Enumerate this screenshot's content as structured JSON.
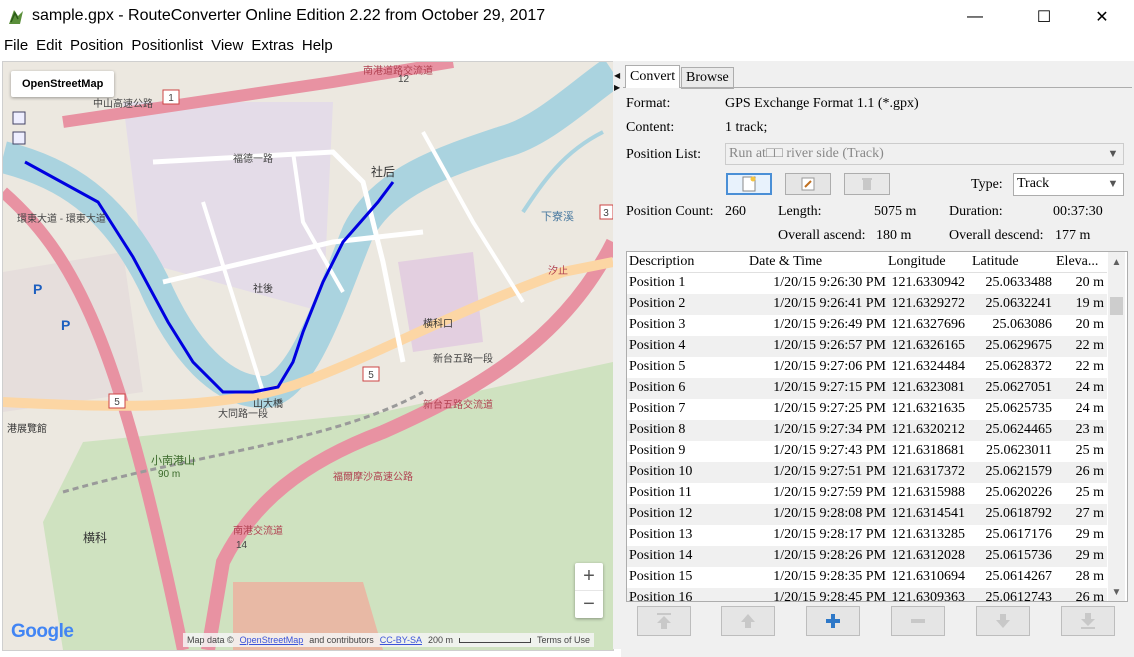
{
  "window": {
    "title": "sample.gpx - RouteConverter Online Edition 2.22 from October 29, 2017",
    "minimize_glyph": "—",
    "maximize_glyph": "☐",
    "close_glyph": "✕"
  },
  "menu": [
    "File",
    "Edit",
    "Position",
    "Positionlist",
    "View",
    "Extras",
    "Help"
  ],
  "map": {
    "type_button": "OpenStreetMap",
    "zoom_in": "+",
    "zoom_out": "−",
    "google_logo": "Google",
    "attribution_prefix": "Map data ©",
    "attribution_osm": "OpenStreetMap",
    "attribution_mid": "and contributors",
    "attribution_license": "CC-BY-SA",
    "scale": "200 m",
    "terms": "Terms of Use",
    "labels": {
      "top_road": "南港道路交流道",
      "left_road": "環東大道 - 環東大道",
      "highway_1": "中山高速公路",
      "place_1": "福德一路",
      "place_2": "社后",
      "place_3": "社後",
      "place_4": "大同路一段",
      "place_5": "福爾摩沙高速公路",
      "place_6": "新台五路交流道",
      "place_7": "小南港山",
      "place_8": "90 m",
      "place_9": "南港交流道",
      "place_10": "新台五路一段",
      "place_11": "横科口",
      "place_12": "港展覽館",
      "place_13": "横科",
      "place_14": "汐止",
      "place_15": "下寮溪",
      "place_16": "山大橋",
      "route_1": "1",
      "route_5": "5",
      "route_12": "12",
      "route_14": "14",
      "route_3": "3"
    },
    "icons": [
      "map-type-icon",
      "zoom-icon"
    ]
  },
  "panel": {
    "tabs": [
      "Convert",
      "Browse"
    ],
    "format_label": "Format:",
    "format_value": "GPS Exchange Format 1.1 (*.gpx)",
    "content_label": "Content:",
    "content_value": "1 track;",
    "position_list_label": "Position List:",
    "position_list_value": "Run at□□ river side (Track)",
    "type_label": "Type:",
    "type_value": "Track",
    "position_count_label": "Position Count:",
    "position_count_value": "260",
    "length_label": "Length:",
    "length_value": "5075 m",
    "duration_label": "Duration:",
    "duration_value": "00:37:30",
    "ascend_label": "Overall ascend:",
    "ascend_value": "180 m",
    "descend_label": "Overall descend:",
    "descend_value": "177 m"
  },
  "table": {
    "columns": [
      "Description",
      "Date & Time",
      "Longitude",
      "Latitude",
      "Eleva..."
    ],
    "rows": [
      {
        "desc": "Position 1",
        "date": "1/20/15 9:26:30 PM",
        "lon": "121.6330942",
        "lat": "25.0633488",
        "ele": "20 m"
      },
      {
        "desc": "Position 2",
        "date": "1/20/15 9:26:41 PM",
        "lon": "121.6329272",
        "lat": "25.0632241",
        "ele": "19 m"
      },
      {
        "desc": "Position 3",
        "date": "1/20/15 9:26:49 PM",
        "lon": "121.6327696",
        "lat": "25.063086",
        "ele": "20 m"
      },
      {
        "desc": "Position 4",
        "date": "1/20/15 9:26:57 PM",
        "lon": "121.6326165",
        "lat": "25.0629675",
        "ele": "22 m"
      },
      {
        "desc": "Position 5",
        "date": "1/20/15 9:27:06 PM",
        "lon": "121.6324484",
        "lat": "25.0628372",
        "ele": "22 m"
      },
      {
        "desc": "Position 6",
        "date": "1/20/15 9:27:15 PM",
        "lon": "121.6323081",
        "lat": "25.0627051",
        "ele": "24 m"
      },
      {
        "desc": "Position 7",
        "date": "1/20/15 9:27:25 PM",
        "lon": "121.6321635",
        "lat": "25.0625735",
        "ele": "24 m"
      },
      {
        "desc": "Position 8",
        "date": "1/20/15 9:27:34 PM",
        "lon": "121.6320212",
        "lat": "25.0624465",
        "ele": "23 m"
      },
      {
        "desc": "Position 9",
        "date": "1/20/15 9:27:43 PM",
        "lon": "121.6318681",
        "lat": "25.0623011",
        "ele": "25 m"
      },
      {
        "desc": "Position 10",
        "date": "1/20/15 9:27:51 PM",
        "lon": "121.6317372",
        "lat": "25.0621579",
        "ele": "26 m"
      },
      {
        "desc": "Position 11",
        "date": "1/20/15 9:27:59 PM",
        "lon": "121.6315988",
        "lat": "25.0620226",
        "ele": "25 m"
      },
      {
        "desc": "Position 12",
        "date": "1/20/15 9:28:08 PM",
        "lon": "121.6314541",
        "lat": "25.0618792",
        "ele": "27 m"
      },
      {
        "desc": "Position 13",
        "date": "1/20/15 9:28:17 PM",
        "lon": "121.6313285",
        "lat": "25.0617176",
        "ele": "29 m"
      },
      {
        "desc": "Position 14",
        "date": "1/20/15 9:28:26 PM",
        "lon": "121.6312028",
        "lat": "25.0615736",
        "ele": "29 m"
      },
      {
        "desc": "Position 15",
        "date": "1/20/15 9:28:35 PM",
        "lon": "121.6310694",
        "lat": "25.0614267",
        "ele": "28 m"
      },
      {
        "desc": "Position 16",
        "date": "1/20/15 9:28:45 PM",
        "lon": "121.6309363",
        "lat": "25.0612743",
        "ele": "26 m"
      }
    ]
  },
  "colors": {
    "route": "#0000e0",
    "river": "#aad3df",
    "motorway": "#e892a2",
    "primary": "#fcd6a4",
    "forest": "#add19e",
    "button_accent": "#4a8fd6"
  }
}
